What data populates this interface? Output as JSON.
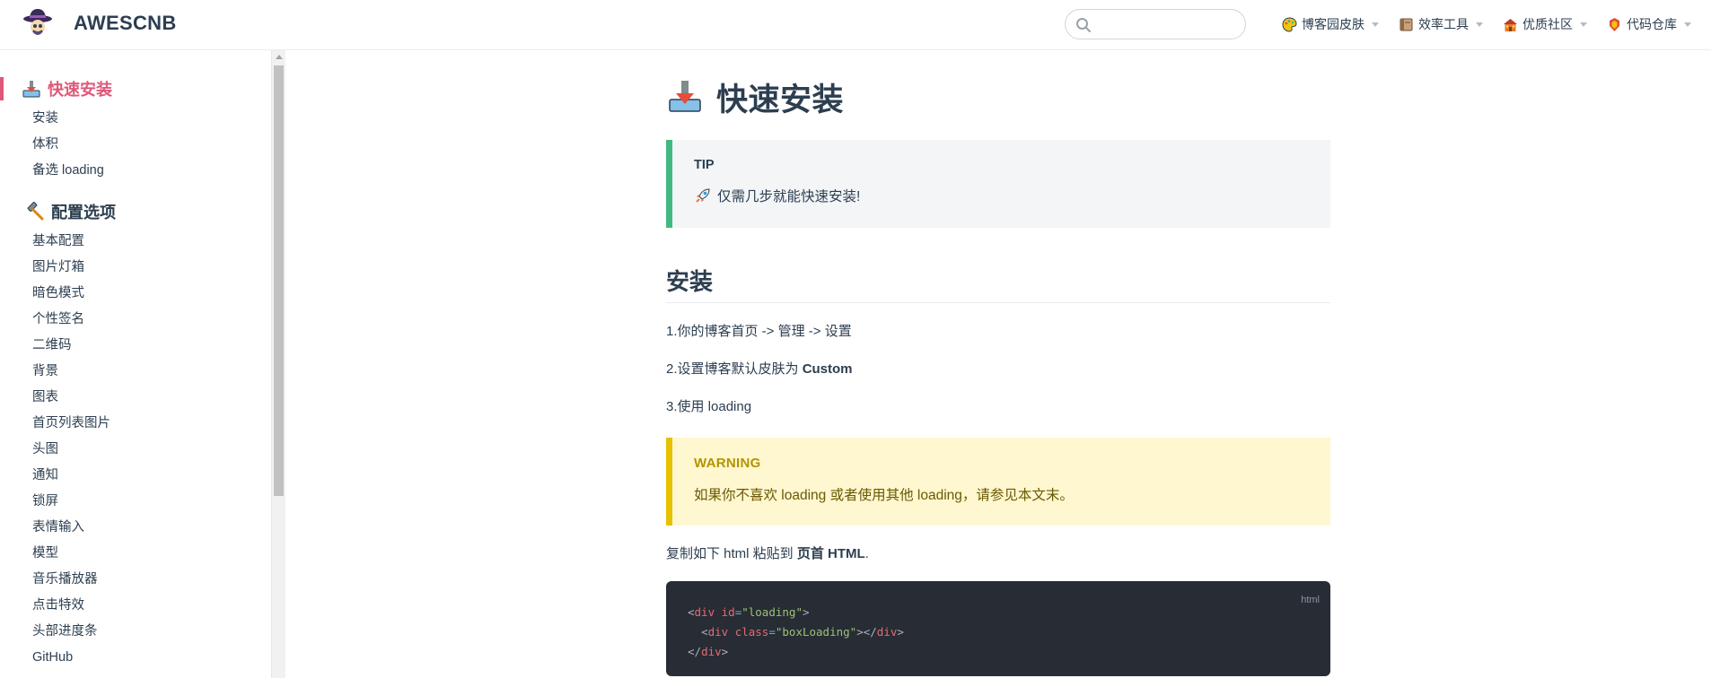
{
  "navbar": {
    "brand": "AWESCNB",
    "search": {
      "value": "",
      "placeholder": ""
    },
    "items": [
      {
        "label": "博客园皮肤",
        "icon": "palette-icon"
      },
      {
        "label": "效率工具",
        "icon": "toolbox-icon"
      },
      {
        "label": "优质社区",
        "icon": "community-icon"
      },
      {
        "label": "代码仓库",
        "icon": "repo-icon"
      }
    ]
  },
  "sidebar": {
    "groups": [
      {
        "title": "快速安装",
        "icon": "install-icon",
        "active": true,
        "items": [
          "安装",
          "体积",
          "备选 loading"
        ]
      },
      {
        "title": "配置选项",
        "icon": "hammer-icon",
        "active": false,
        "items": [
          "基本配置",
          "图片灯箱",
          "暗色模式",
          "个性签名",
          "二维码",
          "背景",
          "图表",
          "首页列表图片",
          "头图",
          "通知",
          "锁屏",
          "表情输入",
          "模型",
          "音乐播放器",
          "点击特效",
          "头部进度条",
          "GitHub"
        ]
      }
    ]
  },
  "content": {
    "title": "快速安装",
    "title_icon": "install-icon",
    "tip": {
      "title": "TIP",
      "icon": "rocket-icon",
      "body": "仅需几步就能快速安装!"
    },
    "section": "安装",
    "steps": {
      "step1": "1.你的博客首页 -> 管理 -> 设置",
      "step2_prefix": "2.设置博客默认皮肤为 ",
      "step2_strong": "Custom",
      "step3": "3.使用 loading"
    },
    "warning": {
      "title": "WARNING",
      "body": "如果你不喜欢 loading 或者使用其他 loading，请参见本文末。"
    },
    "copy_text": {
      "prefix": "复制如下 html 粘贴到 ",
      "strong": "页首 HTML",
      "suffix": "."
    },
    "code": {
      "lang": "html",
      "line1": {
        "open": "<",
        "tag": "div",
        "attr": "id",
        "eq": "=",
        "value": "\"loading\"",
        "close": ">"
      },
      "line2": {
        "indent": "  ",
        "open": "<",
        "tag": "div",
        "attr": "class",
        "eq": "=",
        "value": "\"boxLoading\"",
        "mid": "></",
        "tag2": "div",
        "close": ">"
      },
      "line3": {
        "open": "</",
        "tag": "div",
        "close": ">"
      }
    }
  },
  "colors": {
    "accent": "#e05779",
    "tip_border": "#42b983",
    "warning_border": "#e7c000",
    "code_bg": "#282c34"
  }
}
